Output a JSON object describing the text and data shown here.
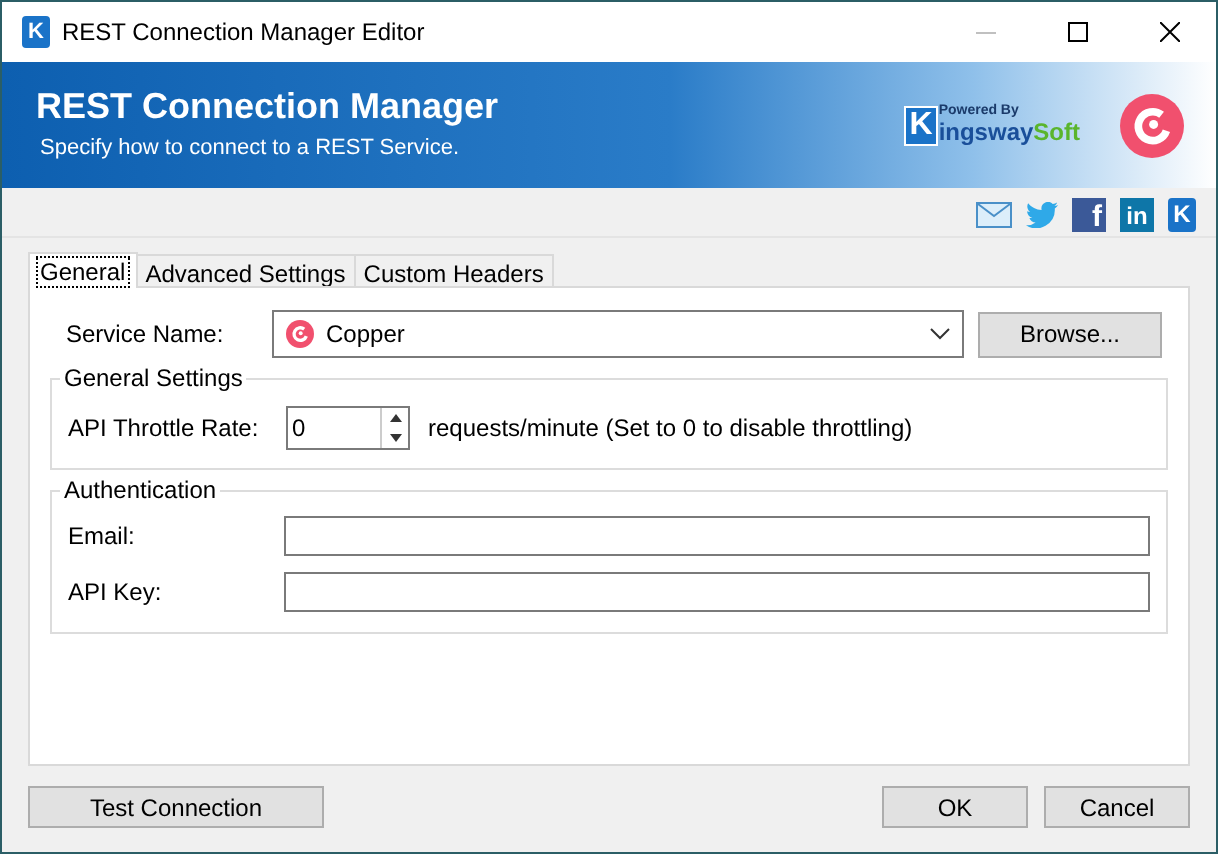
{
  "window": {
    "app_icon": "K",
    "title": "REST Connection Manager Editor"
  },
  "banner": {
    "title": "REST Connection Manager",
    "subtitle": "Specify how to connect to a REST Service.",
    "powered_by": "Powered By",
    "logo_k": "K",
    "logo_main": "ingsway",
    "logo_end": "Soft"
  },
  "social": [
    {
      "kind": "mail"
    },
    {
      "kind": "twitter"
    },
    {
      "kind": "facebook",
      "text": "f"
    },
    {
      "kind": "linkedin",
      "text": "in"
    },
    {
      "kind": "kingsway",
      "text": "K"
    }
  ],
  "tabs": [
    {
      "label": "General",
      "selected": true
    },
    {
      "label": "Advanced Settings",
      "selected": false
    },
    {
      "label": "Custom Headers",
      "selected": false
    }
  ],
  "service": {
    "label": "Service Name:",
    "value": "Copper",
    "browse": "Browse..."
  },
  "general_settings": {
    "title": "General Settings",
    "label": "API Throttle Rate:",
    "value": "0",
    "hint": "requests/minute (Set to 0 to disable throttling)"
  },
  "authentication": {
    "title": "Authentication",
    "fields": [
      {
        "label": "Email:"
      },
      {
        "label": "API Key:"
      }
    ]
  },
  "buttons": {
    "test": "Test Connection",
    "ok": "OK",
    "cancel": "Cancel"
  }
}
